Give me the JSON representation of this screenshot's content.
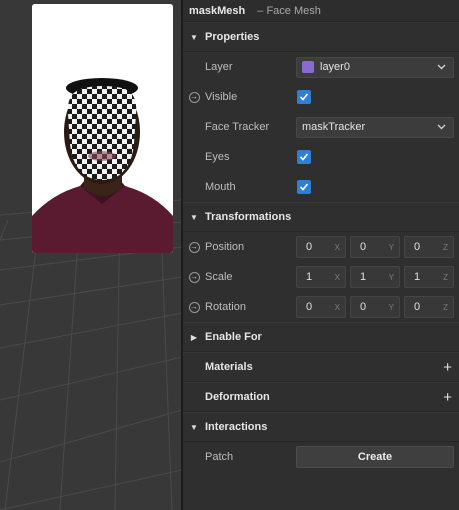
{
  "header": {
    "object_name": "maskMesh",
    "object_type": "– Face Mesh"
  },
  "properties": {
    "title": "Properties",
    "layer": {
      "label": "Layer",
      "value": "layer0",
      "color": "#8a6ad0"
    },
    "visible": {
      "label": "Visible",
      "checked": true
    },
    "face_tracker": {
      "label": "Face Tracker",
      "value": "maskTracker"
    },
    "eyes": {
      "label": "Eyes",
      "checked": true
    },
    "mouth": {
      "label": "Mouth",
      "checked": true
    }
  },
  "transformations": {
    "title": "Transformations",
    "position": {
      "label": "Position",
      "x": "0",
      "y": "0",
      "z": "0"
    },
    "scale": {
      "label": "Scale",
      "x": "1",
      "y": "1",
      "z": "1"
    },
    "rotation": {
      "label": "Rotation",
      "x": "0",
      "y": "0",
      "z": "0"
    },
    "axis_labels": {
      "x": "X",
      "y": "Y",
      "z": "Z"
    }
  },
  "enable_for": {
    "title": "Enable For"
  },
  "materials": {
    "title": "Materials"
  },
  "deformation": {
    "title": "Deformation"
  },
  "interactions": {
    "title": "Interactions",
    "patch": {
      "label": "Patch",
      "button": "Create"
    }
  },
  "colors": {
    "accent": "#2f7fd6",
    "panel": "#2f2f2f",
    "viewport": "#3a3a3a"
  }
}
